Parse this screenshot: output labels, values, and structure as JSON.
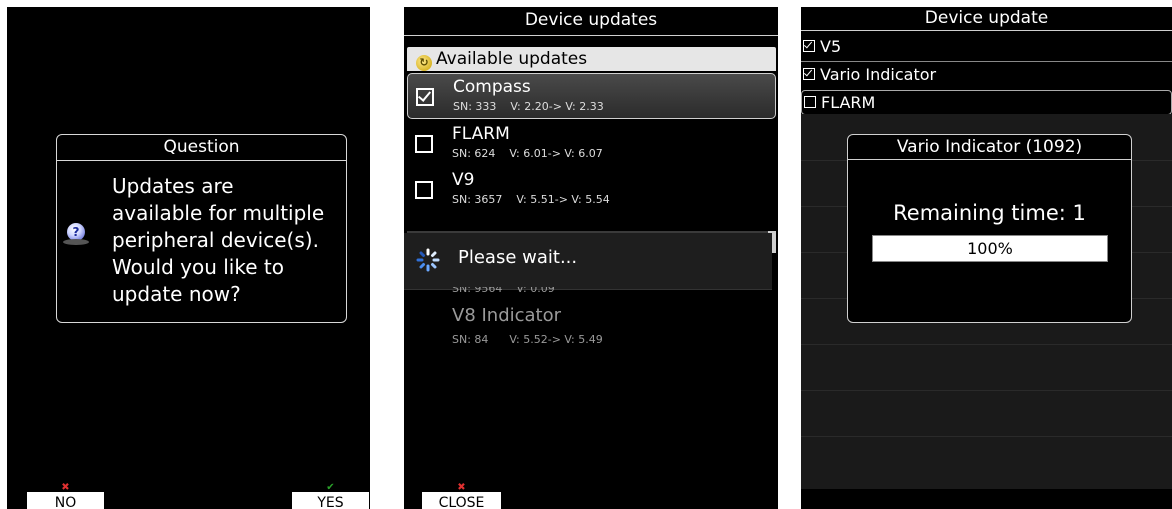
{
  "screen1": {
    "dialog_title": "Question",
    "lines": [
      "Updates are",
      "available for multiple",
      "peripheral device(s).",
      "Would you like to",
      "update now?"
    ],
    "icon": "question-icon",
    "buttons": {
      "no": "NO",
      "yes": "YES"
    }
  },
  "screen2": {
    "title": "Device updates",
    "section_label": "Available updates",
    "devices": [
      {
        "name": "Compass",
        "sn": "SN: 333",
        "version": "V: 2.20-> V: 2.33",
        "checked": true
      },
      {
        "name": "FLARM",
        "sn": "SN: 624",
        "version": "V: 6.01-> V: 6.07",
        "checked": false
      },
      {
        "name": "V9",
        "sn": "SN: 3657",
        "version": "V: 5.51-> V: 5.54",
        "checked": false
      }
    ],
    "wait_text": "Please wait...",
    "partial_row": "SN: 9564    V: 0.09",
    "other_device": {
      "name": "V8 Indicator",
      "sn": "SN: 84",
      "version": "V: 5.52-> V: 5.49"
    },
    "close_label": "CLOSE"
  },
  "screen3": {
    "title": "Device update",
    "items": [
      {
        "label": "V5",
        "checked": true
      },
      {
        "label": "Vario Indicator",
        "checked": true
      },
      {
        "label": "FLARM",
        "checked": false
      }
    ],
    "dialog_title": "Vario Indicator (1092)",
    "remaining_label": "Remaining time:  1",
    "progress_label": "100%",
    "progress": 1.0
  }
}
